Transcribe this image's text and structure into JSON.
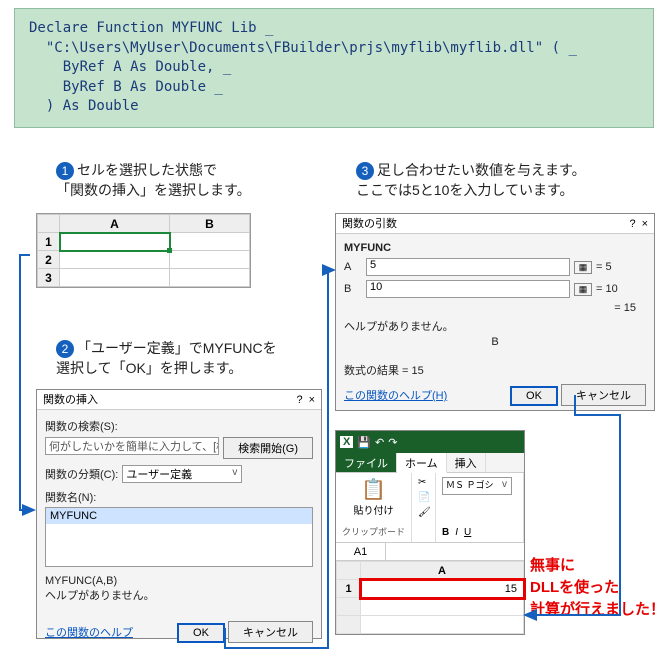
{
  "code": "Declare Function MYFUNC Lib _\n  \"C:\\Users\\MyUser\\Documents\\FBuilder\\prjs\\myflib\\myflib.dll\" ( _\n    ByRef A As Double, _\n    ByRef B As Double _\n  ) As Double",
  "steps": {
    "s1_num": "1",
    "s1": "セルを選択した状態で\n「関数の挿入」を選択します。",
    "s2_num": "2",
    "s2": "「ユーザー定義」でMYFUNCを\n選択して「OK」を押します。",
    "s3_num": "3",
    "s3": "足し合わせたい数値を与えます。\nここでは5と10を入力しています。"
  },
  "sheet": {
    "colA": "A",
    "colB": "B",
    "r1": "1",
    "r2": "2",
    "r3": "3"
  },
  "insertDlg": {
    "title": "関数の挿入",
    "searchLbl": "関数の検索(S):",
    "searchPh": "何がしたいかを簡単に入力して、[検索開始] をクリックしてください。",
    "searchBtn": "検索開始(G)",
    "catLbl": "関数の分類(C):",
    "catVal": "ユーザー定義",
    "nameLbl": "関数名(N):",
    "funcSel": "MYFUNC",
    "sig": "MYFUNC(A,B)",
    "noHelp": "ヘルプがありません。",
    "helpLink": "この関数のヘルプ",
    "ok": "OK",
    "cancel": "キャンセル",
    "close": "×",
    "help": "?"
  },
  "argsDlg": {
    "title": "関数の引数",
    "func": "MYFUNC",
    "aLbl": "A",
    "aVal": "5",
    "aEq": "= 5",
    "bLbl": "B",
    "bVal": "10",
    "bEq": "= 10",
    "resEq": "= 15",
    "noHelp": "ヘルプがありません。",
    "bLine": "B",
    "resultLbl": "数式の結果 = 15",
    "helpLink": "この関数のヘルプ(H)",
    "ok": "OK",
    "cancel": "キャンセル",
    "close": "×",
    "help": "?"
  },
  "excel": {
    "tabFile": "ファイル",
    "tabHome": "ホーム",
    "tabInsert": "挿入",
    "paste": "貼り付け",
    "pasteIcon": "📋",
    "cut": "✂",
    "copy": "📄",
    "brush": "🖌",
    "clipGroup": "クリップボード",
    "font": "ＭＳ Ｐゴシ",
    "bold": "B",
    "italic": "I",
    "under": "U",
    "namebox": "A1",
    "colA": "A",
    "r1": "1",
    "result": "15"
  },
  "callout": "無事に\nDLLを使った\n計算が行えました！"
}
